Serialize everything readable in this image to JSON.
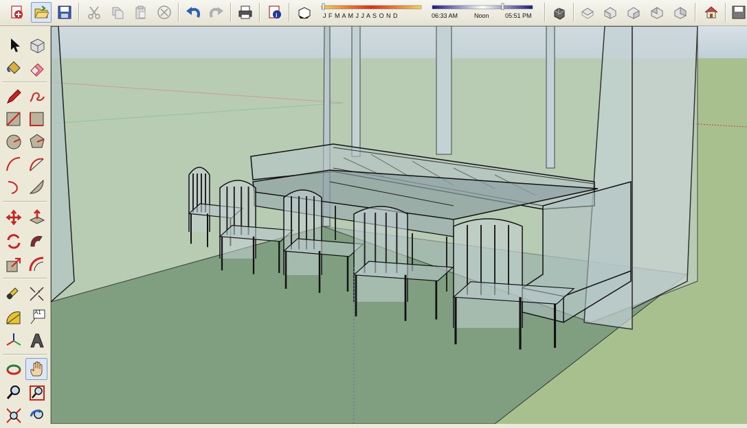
{
  "app": "SketchUp",
  "toolbar": {
    "shadow_months": "J F M A M J J A S O N D",
    "time_start": "06:33 AM",
    "time_mid": "Noon",
    "time_end": "05:51 PM",
    "buttons": [
      "new",
      "open",
      "save",
      "cut",
      "copy",
      "paste",
      "erase",
      "undo",
      "redo",
      "print",
      "model-info",
      "shadows",
      "iso",
      "top",
      "front",
      "right",
      "back",
      "left",
      "home"
    ]
  },
  "sidebar": {
    "tools": [
      "select",
      "make-component",
      "paint-bucket",
      "eraser",
      "pencil",
      "freehand",
      "rectangle",
      "rotated-rectangle",
      "circle",
      "polygon",
      "arc",
      "two-point-arc",
      "three-point-arc",
      "pie",
      "move",
      "push-pull",
      "rotate",
      "follow-me",
      "scale",
      "offset",
      "tape-measure",
      "dimensions",
      "protractor",
      "text",
      "axes",
      "3d-text",
      "orbit",
      "pan",
      "zoom",
      "zoom-window",
      "zoom-extents",
      "previous-view"
    ],
    "active_tool": "pan",
    "text_tool_label": "A1"
  },
  "colors": {
    "sky": "#c9d5df",
    "ground": "#a9c08f",
    "floor": "#86a684",
    "glass": "#c9d6d8"
  }
}
